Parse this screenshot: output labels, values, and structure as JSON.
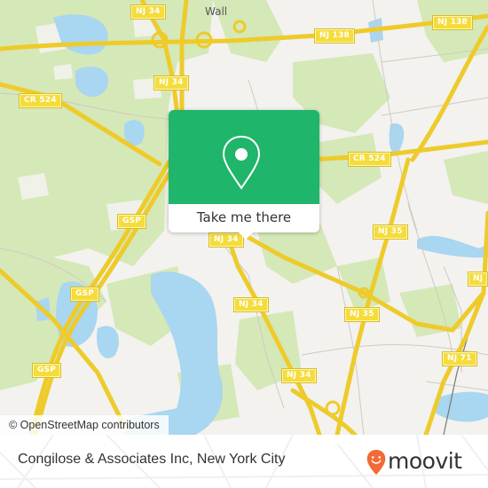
{
  "map": {
    "place_labels": [
      {
        "id": "wall",
        "text": "Wall"
      }
    ],
    "road_shields": [
      {
        "id": "nj34-a",
        "text": "NJ 34"
      },
      {
        "id": "nj34-b",
        "text": "NJ 34"
      },
      {
        "id": "nj34-c",
        "text": "NJ 34"
      },
      {
        "id": "nj34-d",
        "text": "NJ 34"
      },
      {
        "id": "nj34-e",
        "text": "NJ 34"
      },
      {
        "id": "nj138-a",
        "text": "NJ 138"
      },
      {
        "id": "nj138-b",
        "text": "NJ 138"
      },
      {
        "id": "cr524-a",
        "text": "CR 524"
      },
      {
        "id": "cr524-b",
        "text": "CR 524"
      },
      {
        "id": "gsp-a",
        "text": "GSP"
      },
      {
        "id": "gsp-b",
        "text": "GSP"
      },
      {
        "id": "gsp-c",
        "text": "GSP"
      },
      {
        "id": "nj35-a",
        "text": "NJ 35"
      },
      {
        "id": "nj35-b",
        "text": "NJ 35"
      },
      {
        "id": "nj71",
        "text": "NJ 71"
      },
      {
        "id": "nj-partial",
        "text": "NJ"
      }
    ],
    "attribution": "© OpenStreetMap contributors",
    "colors": {
      "land": "#f3f2ef",
      "park": "#d5e8b8",
      "water": "#a9d6f0",
      "road": "#f5dc3a"
    }
  },
  "popup": {
    "icon": "location-pin-icon",
    "button_label": "Take me there",
    "accent_color": "#1fb56a"
  },
  "footer": {
    "title": "Congilose & Associates Inc, New York City",
    "brand": "moovit",
    "brand_color": "#f26a35"
  }
}
